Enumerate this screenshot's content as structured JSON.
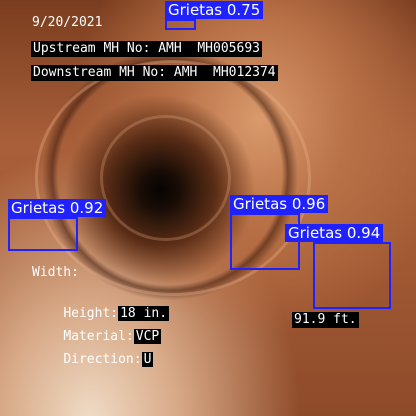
{
  "overlay": {
    "date": "9/20/2021",
    "upstream": "Upstream MH No: AMH  MH005693",
    "downstream": "Downstream MH No: AMH  MH012374",
    "width_label": "Width:",
    "height_label": "Height:",
    "height_value": "18 in.",
    "material_label": "Material:",
    "material_value": "VCP",
    "direction_label": "Direction:",
    "direction_value": "U",
    "distance": "91.9 ft."
  },
  "detections": [
    {
      "label": "Grietas 0.75"
    },
    {
      "label": "Grietas 0.92"
    },
    {
      "label": "Grietas 0.96"
    },
    {
      "label": "Grietas 0.94"
    }
  ],
  "colors": {
    "box": "#1f22ff",
    "text": "#ffffff"
  }
}
